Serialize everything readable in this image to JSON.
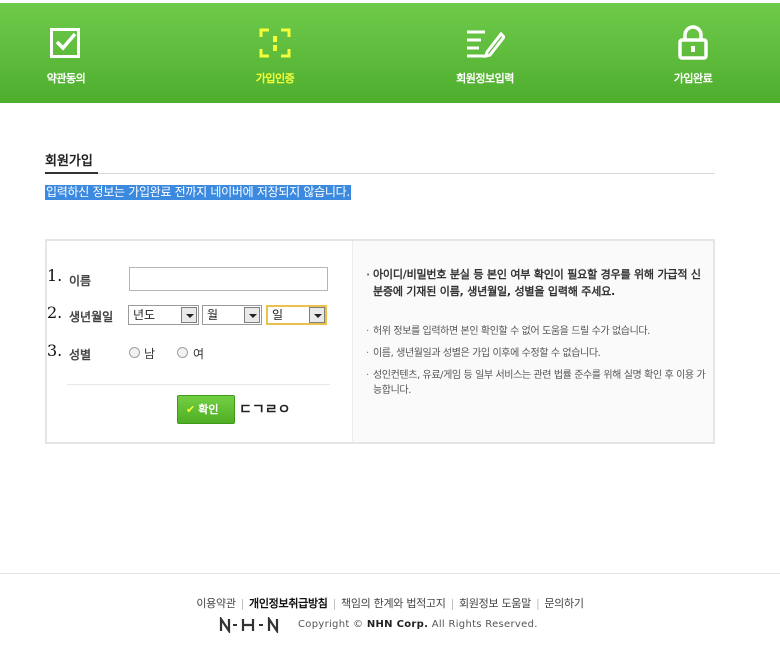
{
  "steps": [
    {
      "label": "약관동의",
      "icon": "checkbox-icon",
      "active": false
    },
    {
      "label": "가입인증",
      "icon": "scan-frame-icon",
      "active": true
    },
    {
      "label": "회원정보입력",
      "icon": "form-pen-icon",
      "active": false
    },
    {
      "label": "가입완료",
      "icon": "lock-icon",
      "active": false
    }
  ],
  "colors": {
    "brand_green": "#59b935",
    "active_yellow": "#f4ff3a",
    "highlight_blue": "#3c8ae0"
  },
  "section": {
    "title": "회원가입",
    "notice": "입력하신 정보는 가입완료 전까지 네이버에 저장되지 않습니다."
  },
  "form": {
    "rows": [
      {
        "num": "1.",
        "label": "이름"
      },
      {
        "num": "2.",
        "label": "생년월일"
      },
      {
        "num": "3.",
        "label": "성별"
      }
    ],
    "name_value": "",
    "birth": {
      "year": "년도",
      "month": "월",
      "day": "일"
    },
    "gender": {
      "male": "남",
      "female": "여"
    },
    "confirm_label": "확인",
    "confirm_extra": "ㄷㄱㄹㅇ"
  },
  "info": {
    "main": "아이디/비밀번호 분실 등 본인 여부 확인이 필요할 경우를 위해 가급적 신분증에 기재된 이름, 생년월일, 성별을 입력해 주세요.",
    "items": [
      "허위 정보를 입력하면 본인 확인할 수 없어 도움을 드릴 수가 없습니다.",
      "이름, 생년월일과 성별은 가입 이후에 수정할 수 없습니다.",
      "성인컨텐츠, 유료/게임 등 일부 서비스는 관련 법률 준수를 위해 실명 확인 후 이용 가능합니다."
    ]
  },
  "footer": {
    "links": [
      "이용약관",
      "개인정보취급방침",
      "책임의 한계와 법적고지",
      "회원정보 도움말",
      "문의하기"
    ],
    "logo": "NHN",
    "copyright_prefix": "Copyright ©",
    "company": "NHN Corp.",
    "rights": "All Rights Reserved."
  }
}
